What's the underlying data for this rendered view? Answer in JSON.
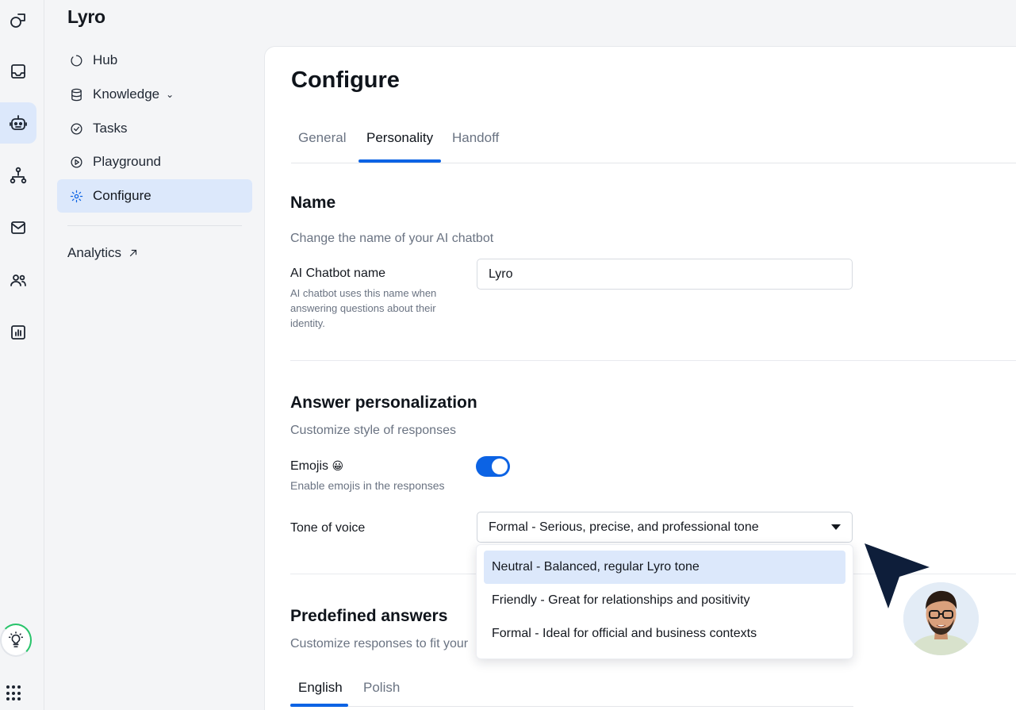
{
  "rail": {
    "items": [
      "shapes-icon",
      "inbox-icon",
      "bot-icon",
      "flow-icon",
      "mail-icon",
      "people-icon",
      "chart-icon"
    ],
    "active_index": 2
  },
  "sidebar": {
    "app_title": "Lyro",
    "items": [
      {
        "label": "Hub",
        "icon": "hub-icon"
      },
      {
        "label": "Knowledge",
        "icon": "database-icon"
      },
      {
        "label": "Tasks",
        "icon": "check-circle-icon"
      },
      {
        "label": "Playground",
        "icon": "play-circle-icon"
      },
      {
        "label": "Configure",
        "icon": "gear-icon"
      }
    ],
    "active_item": "Configure",
    "analytics_label": "Analytics"
  },
  "main": {
    "title": "Configure",
    "tabs": [
      "General",
      "Personality",
      "Handoff"
    ],
    "active_tab": "Personality",
    "name_section": {
      "title": "Name",
      "subtitle": "Change the name of your AI chatbot",
      "field_label": "AI Chatbot name",
      "field_help": "AI chatbot uses this name when answering questions about their identity.",
      "field_value": "Lyro"
    },
    "personalization": {
      "title": "Answer personalization",
      "subtitle": "Customize style of responses",
      "emojis_label": "Emojis",
      "emojis_emoji": "😀",
      "emojis_help": "Enable emojis in the responses",
      "emojis_enabled": true,
      "tone_label": "Tone of voice",
      "tone_value": "Formal - Serious, precise, and professional tone",
      "tone_options": [
        "Neutral - Balanced, regular Lyro tone",
        "Friendly - Great for relationships and positivity",
        "Formal - Ideal for official and business contexts"
      ],
      "highlighted_option": 0
    },
    "predefined": {
      "title": "Predefined answers",
      "subtitle": "Customize responses to fit your",
      "lang_tabs": [
        "English",
        "Polish"
      ],
      "active_lang": "English"
    }
  },
  "colors": {
    "accent": "#0c63e4",
    "active_bg": "#dce8fb",
    "cursor": "#0e1e3a"
  }
}
